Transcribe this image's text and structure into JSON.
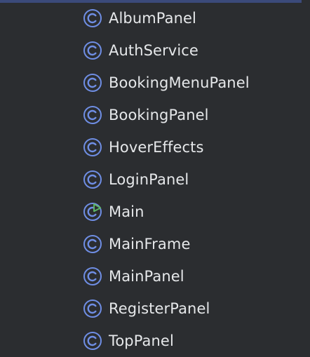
{
  "colors": {
    "background": "#2b2d30",
    "accent_bar": "#3b4a7a",
    "class_icon": "#6f8ee4",
    "run_marker": "#5fb865",
    "text": "#e6e8ea"
  },
  "project_tree": {
    "items": [
      {
        "label": "AlbumPanel",
        "icon": "class-icon"
      },
      {
        "label": "AuthService",
        "icon": "class-icon"
      },
      {
        "label": "BookingMenuPanel",
        "icon": "class-icon"
      },
      {
        "label": "BookingPanel",
        "icon": "class-icon"
      },
      {
        "label": "HoverEffects",
        "icon": "class-icon"
      },
      {
        "label": "LoginPanel",
        "icon": "class-icon"
      },
      {
        "label": "Main",
        "icon": "runnable-class-icon"
      },
      {
        "label": "MainFrame",
        "icon": "class-icon"
      },
      {
        "label": "MainPanel",
        "icon": "class-icon"
      },
      {
        "label": "RegisterPanel",
        "icon": "class-icon"
      },
      {
        "label": "TopPanel",
        "icon": "class-icon"
      }
    ]
  }
}
